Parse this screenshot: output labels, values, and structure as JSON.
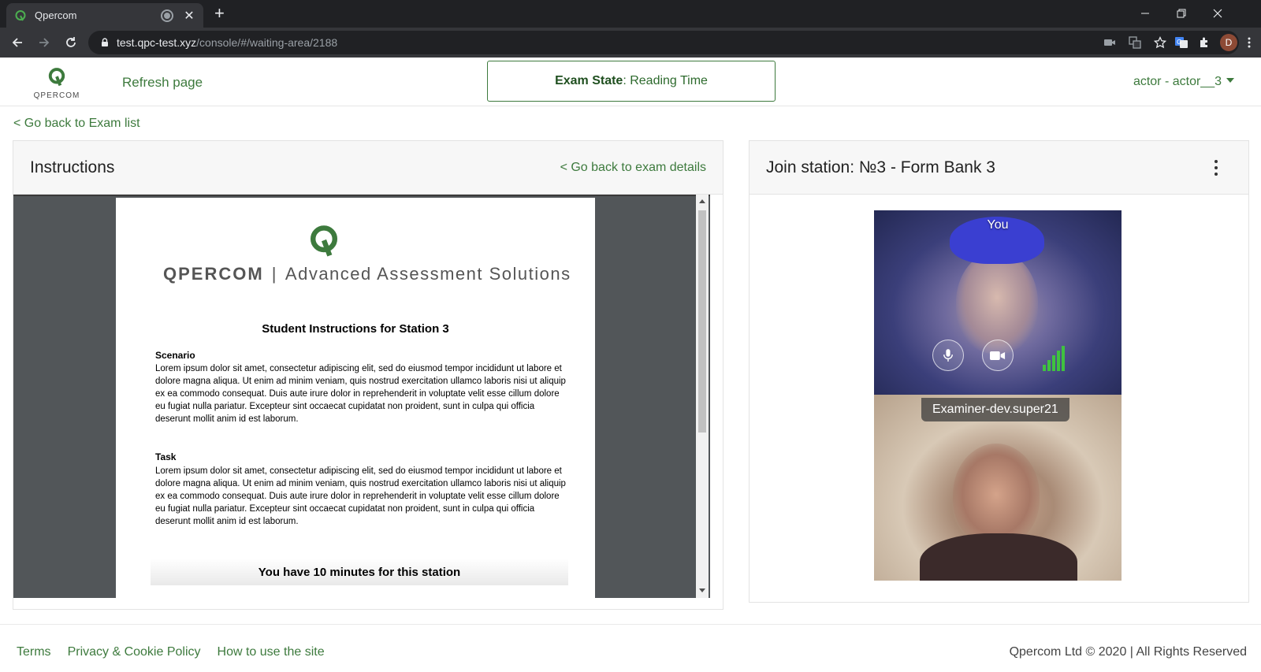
{
  "browser": {
    "tab_title": "Qpercom",
    "url_host": "test.qpc-test.xyz",
    "url_path": "/console/#/waiting-area/2188",
    "profile_initial": "D"
  },
  "header": {
    "logo_text": "QPERCOM",
    "refresh_label": "Refresh page",
    "exam_state_label": "Exam State",
    "exam_state_value": ": Reading Time",
    "user_label": "actor - actor__3"
  },
  "nav": {
    "back_exam_list": "< Go back to Exam list"
  },
  "instructions": {
    "title": "Instructions",
    "back_details": "< Go back to exam details",
    "pdf": {
      "brand_company": "QPERCOM",
      "brand_separator": "|",
      "brand_tagline": "Advanced Assessment Solutions",
      "heading": "Student Instructions for Station 3",
      "scenario_title": "Scenario",
      "scenario_text": "Lorem ipsum dolor sit amet, consectetur adipiscing elit, sed do eiusmod tempor incididunt ut labore et dolore magna aliqua. Ut enim ad minim veniam, quis nostrud exercitation ullamco laboris nisi ut aliquip ex ea commodo consequat. Duis aute irure dolor in reprehenderit in voluptate velit esse cillum dolore eu fugiat nulla pariatur. Excepteur sint occaecat cupidatat non proident, sunt in culpa qui officia deserunt mollit anim id est laborum.",
      "task_title": "Task",
      "task_text": "Lorem ipsum dolor sit amet, consectetur adipiscing elit, sed do eiusmod tempor incididunt ut labore et dolore magna aliqua. Ut enim ad minim veniam, quis nostrud exercitation ullamco laboris nisi ut aliquip ex ea commodo consequat. Duis aute irure dolor in reprehenderit in voluptate velit esse cillum dolore eu fugiat nulla pariatur. Excepteur sint occaecat cupidatat non proident, sunt in culpa qui officia deserunt mollit anim id est laborum.",
      "time_notice": "You have 10 minutes for this station"
    }
  },
  "station": {
    "title": "Join station: №3 - Form Bank 3",
    "self_label": "You",
    "examiner_label": "Examiner-dev.super21"
  },
  "footer": {
    "links": [
      "Terms",
      "Privacy & Cookie Policy",
      "How to use the site"
    ],
    "copyright": "Qpercom Ltd © 2020 | All Rights Reserved"
  },
  "colors": {
    "brand_green": "#3d7a3d",
    "signal_green": "#3fc23f"
  }
}
